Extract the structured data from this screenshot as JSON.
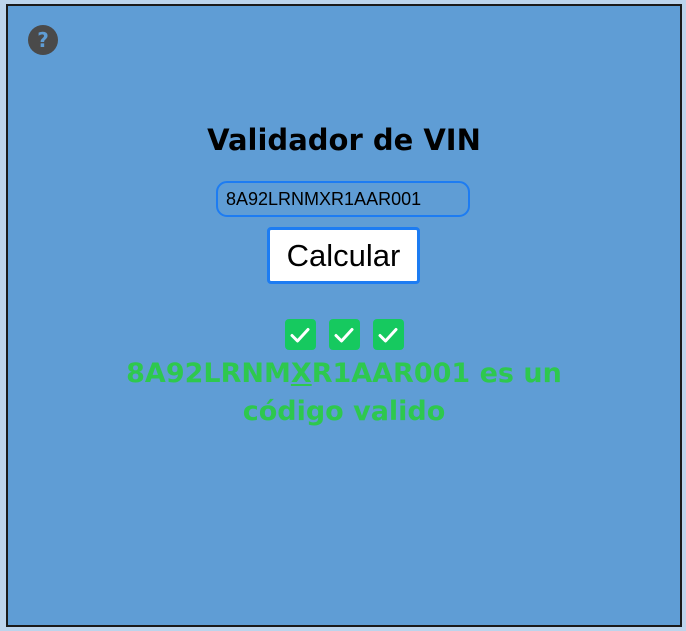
{
  "help": {
    "icon": "question-icon",
    "label": "?"
  },
  "title": "Validador de VIN",
  "vin_input": {
    "value": "8A92LRNMXR1AAR001"
  },
  "calculate_button": {
    "label": "Calcular"
  },
  "checks": [
    {
      "icon": "checkmark-icon"
    },
    {
      "icon": "checkmark-icon"
    },
    {
      "icon": "checkmark-icon"
    }
  ],
  "result": {
    "vin_before": "8A92LRNM",
    "vin_highlight": "X",
    "vin_after": "R1AAR001",
    "message_line1_suffix": " es un",
    "message_line2": "código valido"
  },
  "colors": {
    "background": "#5f9dd5",
    "accent": "#1d7cf2",
    "success": "#2ec84e",
    "check_bg": "#16c95f"
  }
}
